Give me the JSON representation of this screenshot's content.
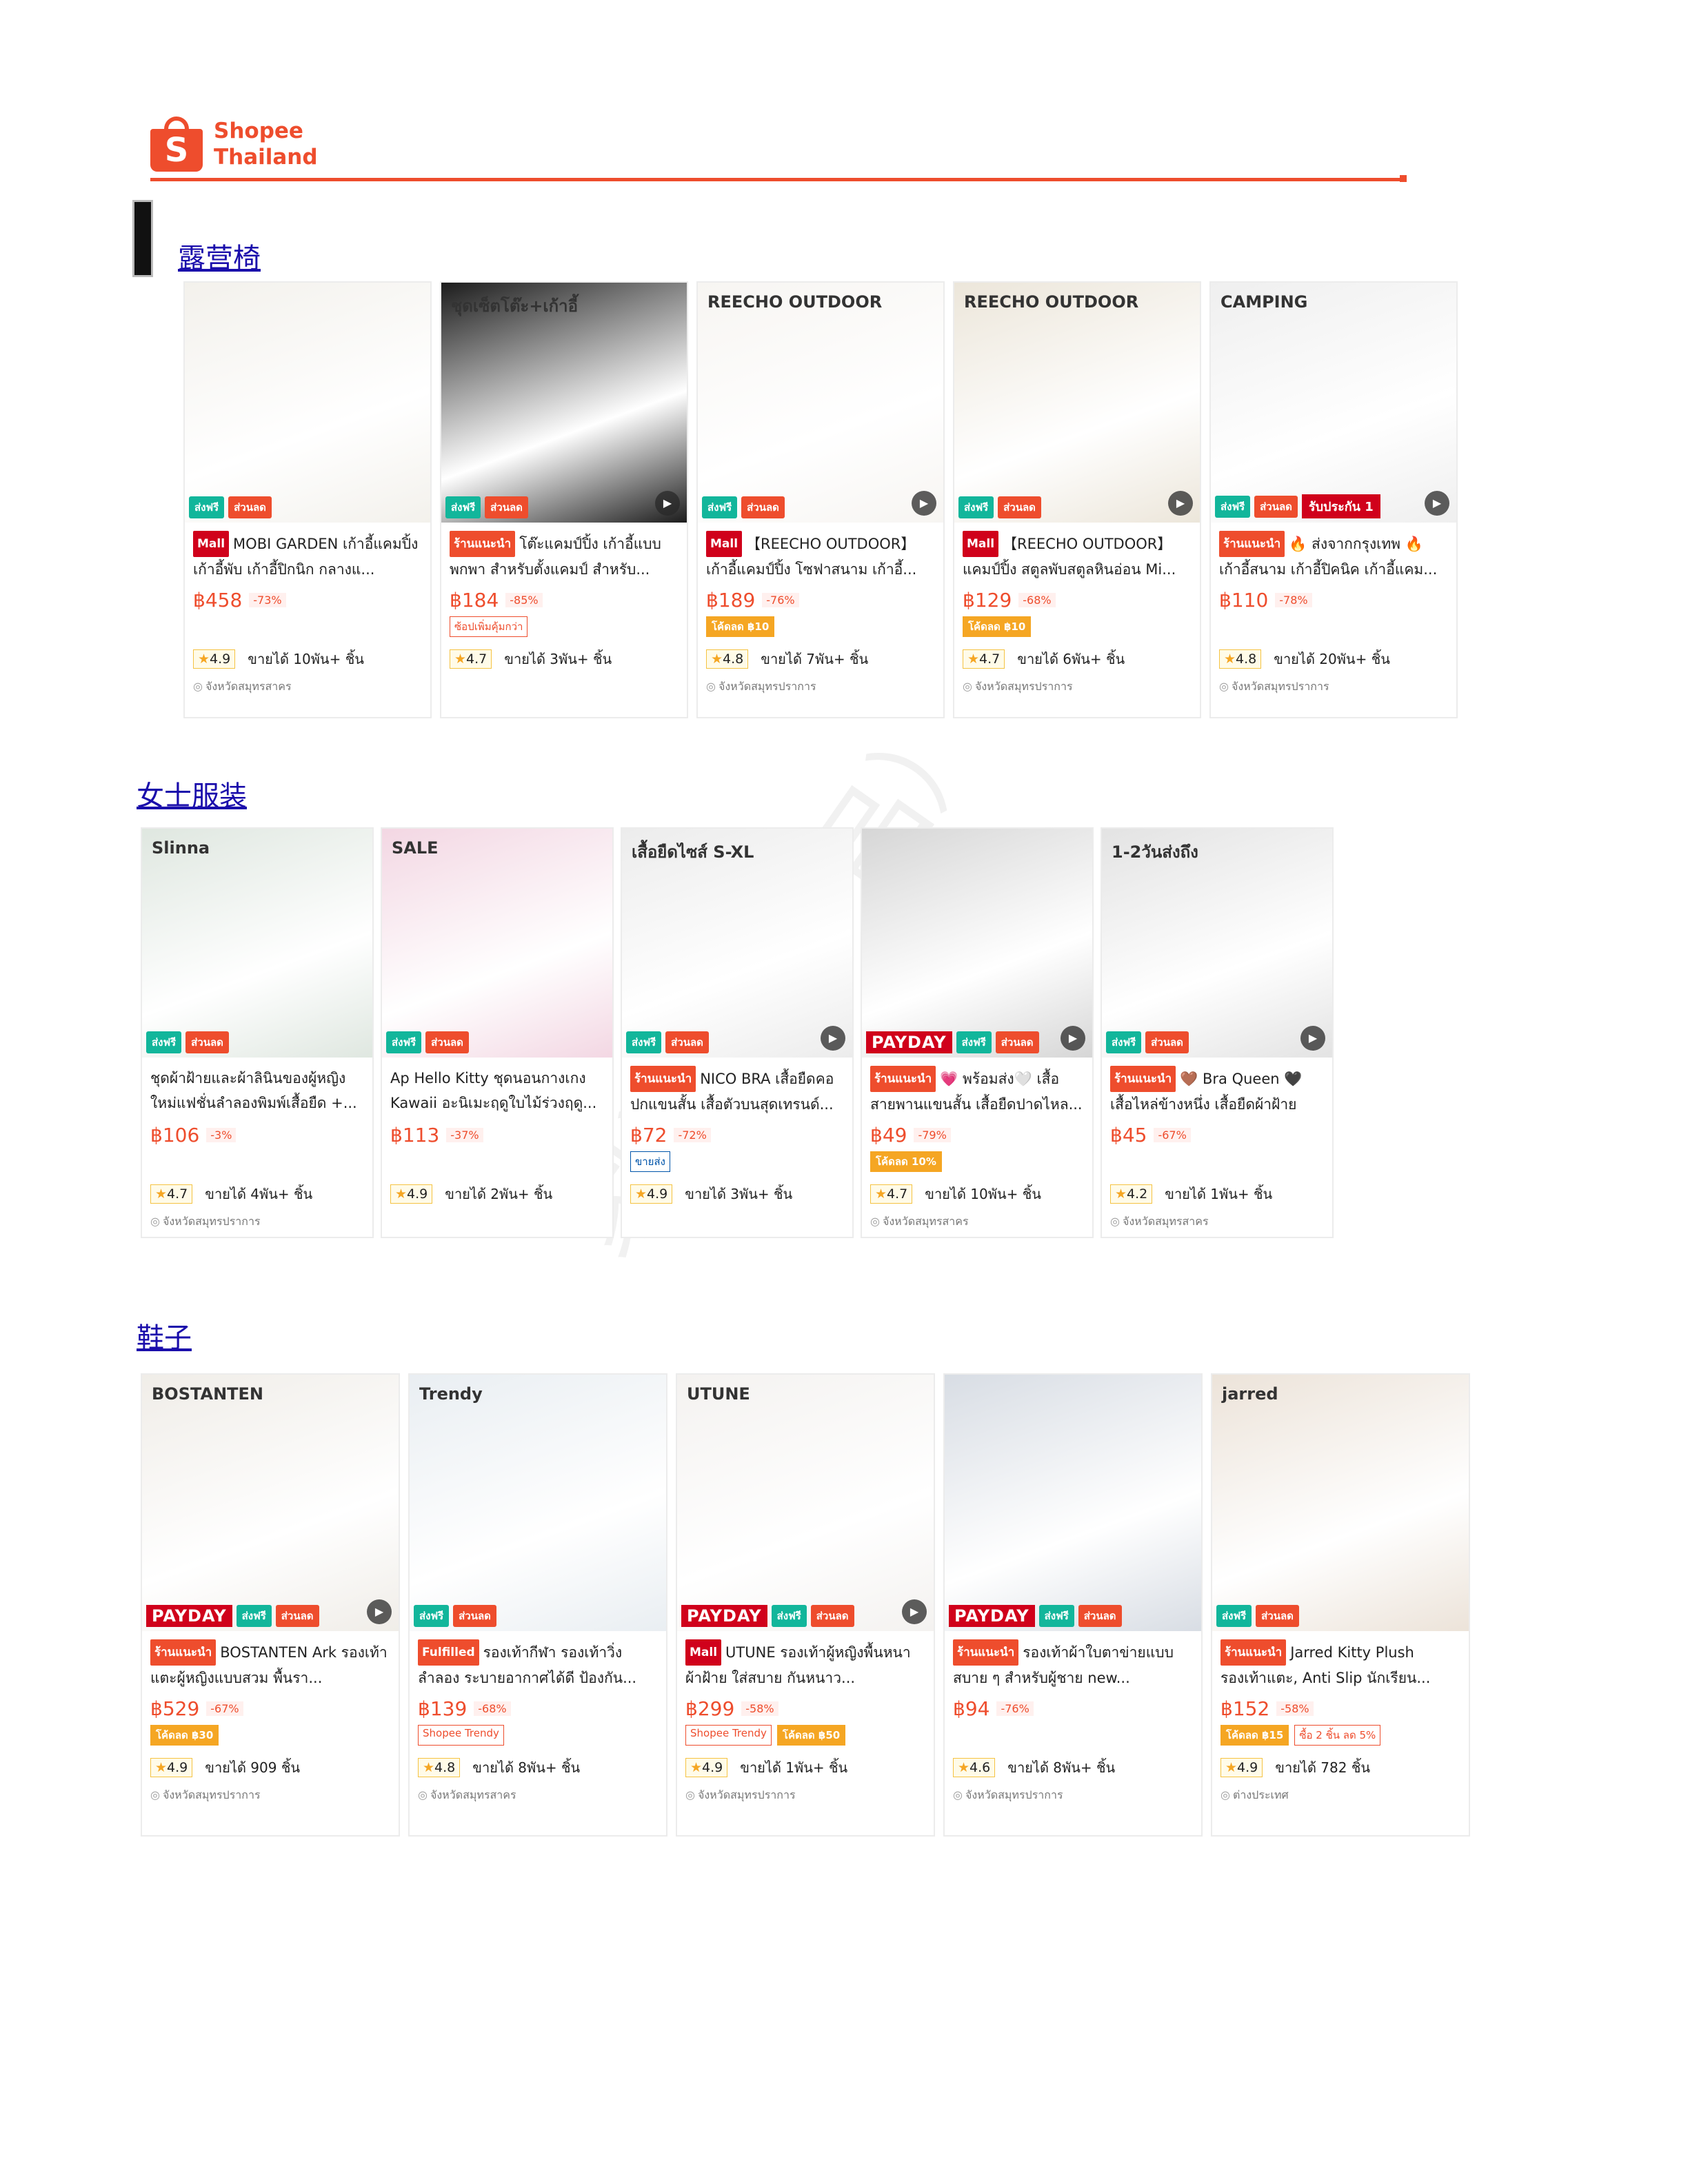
{
  "brand": {
    "line1": "Shopee",
    "line2": "Thailand",
    "bag_letter": "S"
  },
  "watermark": "家学 （产品）",
  "sections": [
    {
      "title": "露营椅",
      "products": [
        {
          "overlay_text": "",
          "tag": "Mall",
          "title": "MOBI GARDEN เก้าอี้แคมปิ้ง เก้าอี้พับ เก้าอี้ปิกนิก กลางแ...",
          "price": "฿458",
          "discount": "-73%",
          "chips": [],
          "rating": "4.9",
          "sold": "ขายได้ 10พัน+ ชิ้น",
          "location": "จังหวัดสมุทรสาคร",
          "badges": {
            "payday": "",
            "free": "ส่งฟรี",
            "disc": "ส่วนลด",
            "extra": ""
          },
          "play": false
        },
        {
          "overlay_text": "ชุดเซ็ตโต๊ะ+เก้าอี้",
          "tag": "ร้านแนะนำ",
          "title": "โต๊ะแคมป์ปิ้ง เก้าอี้แบบพกพา สำหรับตั้งแคมป์ สำหรับ...",
          "price": "฿184",
          "discount": "-85%",
          "chips": [
            "ซ้อปเพิ่มคุ้มกว่า"
          ],
          "rating": "4.7",
          "sold": "ขายได้ 3พัน+ ชิ้น",
          "location": "",
          "badges": {
            "payday": "",
            "free": "ส่งฟรี",
            "disc": "ส่วนลด",
            "extra": ""
          },
          "play": true
        },
        {
          "overlay_text": "REECHO OUTDOOR",
          "tag": "Mall",
          "title": "【REECHO OUTDOOR】เก้าอี้แคมป์ปิ้ง โซฟาสนาม เก้าอี้...",
          "price": "฿189",
          "discount": "-76%",
          "chips": [
            "โค้ดลด ฿10"
          ],
          "rating": "4.8",
          "sold": "ขายได้ 7พัน+ ชิ้น",
          "location": "จังหวัดสมุทรปราการ",
          "badges": {
            "payday": "",
            "free": "ส่งฟรี",
            "disc": "ส่วนลด",
            "extra": ""
          },
          "play": true
        },
        {
          "overlay_text": "REECHO OUTDOOR",
          "tag": "Mall",
          "title": "【REECHO OUTDOOR】แคมป์ปิ้ง สตูลพับสตูลหินอ่อน Mi...",
          "price": "฿129",
          "discount": "-68%",
          "chips": [
            "โค้ดลด ฿10"
          ],
          "rating": "4.7",
          "sold": "ขายได้ 6พัน+ ชิ้น",
          "location": "จังหวัดสมุทรปราการ",
          "badges": {
            "payday": "",
            "free": "ส่งฟรี",
            "disc": "ส่วนลด",
            "extra": ""
          },
          "play": true
        },
        {
          "overlay_text": "CAMPING",
          "tag": "ร้านแนะนำ",
          "title": "🔥 ส่งจากกรุงเทพ 🔥 เก้าอี้สนาม เก้าอี้ปิคนิค เก้าอี้แคม...",
          "price": "฿110",
          "discount": "-78%",
          "chips": [],
          "rating": "4.8",
          "sold": "ขายได้ 20พัน+ ชิ้น",
          "location": "จังหวัดสมุทรปราการ",
          "badges": {
            "payday": "",
            "free": "ส่งฟรี",
            "disc": "ส่วนลด",
            "extra": "รับประกัน 1"
          },
          "play": true
        }
      ]
    },
    {
      "title": "女士服装",
      "products": [
        {
          "overlay_text": "Slinna",
          "tag": "",
          "title": "ชุดผ้าฝ้ายและผ้าลินินของผู้หญิงใหม่แฟชั่นลำลองพิมพ์เสื้อยืด +...",
          "price": "฿106",
          "discount": "-3%",
          "chips": [],
          "rating": "4.7",
          "sold": "ขายได้ 4พัน+ ชิ้น",
          "location": "จังหวัดสมุทรปราการ",
          "badges": {
            "payday": "",
            "free": "ส่งฟรี",
            "disc": "ส่วนลด",
            "extra": ""
          },
          "play": false
        },
        {
          "overlay_text": "SALE",
          "tag": "",
          "title": "Ap Hello Kitty ชุดนอนกางเกง Kawaii อะนิเมะฤดูใบไม้ร่วงฤดู...",
          "price": "฿113",
          "discount": "-37%",
          "chips": [],
          "rating": "4.9",
          "sold": "ขายได้ 2พัน+ ชิ้น",
          "location": "",
          "badges": {
            "payday": "",
            "free": "ส่งฟรี",
            "disc": "ส่วนลด",
            "extra": ""
          },
          "play": false
        },
        {
          "overlay_text": "เสื้อยืดไซส์ S-XL",
          "tag": "ร้านแนะนำ",
          "title": "NICO BRA เสื้อยืดคอปกแขนสั้น เสื้อตัวบนสุดเทรนด์...",
          "price": "฿72",
          "discount": "-72%",
          "chips": [
            "ขายส่ง"
          ],
          "rating": "4.9",
          "sold": "ขายได้ 3พัน+ ชิ้น",
          "location": "",
          "badges": {
            "payday": "",
            "free": "ส่งฟรี",
            "disc": "ส่วนลด",
            "extra": ""
          },
          "play": true
        },
        {
          "overlay_text": "",
          "tag": "ร้านแนะนำ",
          "title": "💗 พร้อมส่ง🤍 เสื้อสายพานแขนสั้น เสื้อยืดปาดไหล...",
          "price": "฿49",
          "discount": "-79%",
          "chips": [
            "โค้ดลด 10%"
          ],
          "rating": "4.7",
          "sold": "ขายได้ 10พัน+ ชิ้น",
          "location": "จังหวัดสมุทรสาคร",
          "badges": {
            "payday": "PAYDAY",
            "free": "ส่งฟรี",
            "disc": "ส่วนลด",
            "extra": ""
          },
          "play": true
        },
        {
          "overlay_text": "1-2วันส่งถึง",
          "tag": "ร้านแนะนำ",
          "title": "🤎 Bra Queen 🖤 เสื้อไหล่ข้างหนึ่ง เสื้อยืดผ้าฝ้าย ควา...",
          "price": "฿45",
          "discount": "-67%",
          "chips": [],
          "rating": "4.2",
          "sold": "ขายได้ 1พัน+ ชิ้น",
          "location": "จังหวัดสมุทรสาคร",
          "badges": {
            "payday": "",
            "free": "ส่งฟรี",
            "disc": "ส่วนลด",
            "extra": ""
          },
          "play": true
        }
      ]
    },
    {
      "title": "鞋子",
      "products": [
        {
          "overlay_text": "BOSTANTEN",
          "tag": "ร้านแนะนำ",
          "title": "BOSTANTEN Ark รองเท้าแตะผู้หญิงแบบสวม พื้นรา...",
          "price": "฿529",
          "discount": "-67%",
          "chips": [
            "โค้ดลด ฿30"
          ],
          "rating": "4.9",
          "sold": "ขายได้ 909 ชิ้น",
          "location": "จังหวัดสมุทรปราการ",
          "badges": {
            "payday": "PAYDAY",
            "free": "ส่งฟรี",
            "disc": "ส่วนลด",
            "extra": ""
          },
          "play": true
        },
        {
          "overlay_text": "Trendy",
          "tag": "Fulfilled",
          "title": "รองเท้ากีฬา รองเท้าวิ่ง ลำลอง ระบายอากาศได้ดี ป้องกัน...",
          "price": "฿139",
          "discount": "-68%",
          "chips": [
            "Shopee Trendy"
          ],
          "rating": "4.8",
          "sold": "ขายได้ 8พัน+ ชิ้น",
          "location": "จังหวัดสมุทรสาคร",
          "badges": {
            "payday": "",
            "free": "ส่งฟรี",
            "disc": "ส่วนลด",
            "extra": ""
          },
          "play": false
        },
        {
          "overlay_text": "UTUNE",
          "tag": "Mall",
          "title": "UTUNE รองเท้าผู้หญิงพื้นหนา ผ้าฝ้าย ใส่สบาย กันหนาว...",
          "price": "฿299",
          "discount": "-58%",
          "chips": [
            "Shopee Trendy",
            "โค้ดลด ฿50"
          ],
          "rating": "4.9",
          "sold": "ขายได้ 1พัน+ ชิ้น",
          "location": "จังหวัดสมุทรปราการ",
          "badges": {
            "payday": "PAYDAY",
            "free": "ส่งฟรี",
            "disc": "ส่วนลด",
            "extra": ""
          },
          "play": true
        },
        {
          "overlay_text": "",
          "tag": "ร้านแนะนำ",
          "title": "รองเท้าผ้าใบตาข่ายแบบสบาย ๆ สำหรับผู้ชาย new...",
          "price": "฿94",
          "discount": "-76%",
          "chips": [],
          "rating": "4.6",
          "sold": "ขายได้ 8พัน+ ชิ้น",
          "location": "จังหวัดสมุทรปราการ",
          "badges": {
            "payday": "PAYDAY",
            "free": "ส่งฟรี",
            "disc": "ส่วนลด",
            "extra": ""
          },
          "play": false
        },
        {
          "overlay_text": "jarred",
          "tag": "ร้านแนะนำ",
          "title": "Jarred Kitty Plush รองเท้าแตะ, Anti Slip นักเรียน...",
          "price": "฿152",
          "discount": "-58%",
          "chips": [
            "โค้ดลด ฿15",
            "ซื้อ 2 ชิ้น ลด 5%"
          ],
          "rating": "4.9",
          "sold": "ขายได้ 782 ชิ้น",
          "location": "ต่างประเทศ",
          "badges": {
            "payday": "",
            "free": "ส่งฟรี",
            "disc": "ส่วนลด",
            "extra": ""
          },
          "play": false
        }
      ]
    }
  ],
  "colors": {
    "brand": "#ee4d2d",
    "mall": "#d0011b",
    "free_ship": "#12b69b",
    "link": "#1a0dab"
  }
}
